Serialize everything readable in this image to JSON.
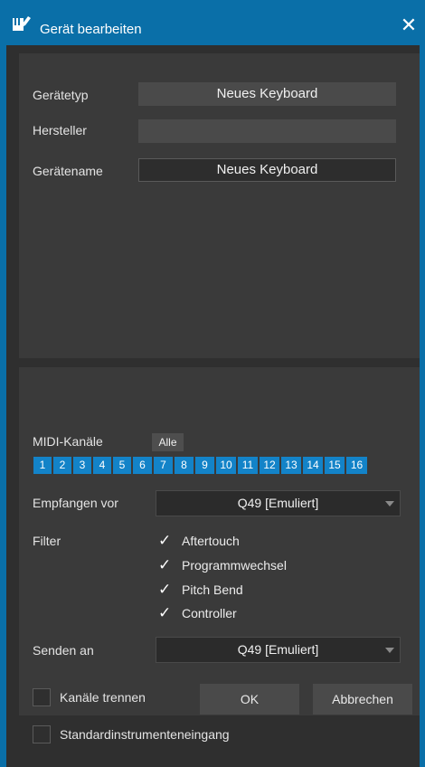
{
  "window": {
    "title": "Gerät bearbeiten",
    "close_glyph": "✕",
    "icon": "keyboard-app-icon"
  },
  "device": {
    "type_label": "Gerätetyp",
    "type_value": "Neues Keyboard",
    "manufacturer_label": "Hersteller",
    "manufacturer_value": "",
    "name_label": "Gerätename",
    "name_value": "Neues Keyboard"
  },
  "midi": {
    "channels_label": "MIDI-Kanäle",
    "all_label": "Alle",
    "channels": [
      "1",
      "2",
      "3",
      "4",
      "5",
      "6",
      "7",
      "8",
      "9",
      "10",
      "11",
      "12",
      "13",
      "14",
      "15",
      "16"
    ],
    "receive_label": "Empfangen vor",
    "receive_value": "Q49 [Emuliert]",
    "filter_label": "Filter",
    "filters": [
      "Aftertouch",
      "Programmwechsel",
      "Pitch Bend",
      "Controller"
    ],
    "check_glyph": "✓",
    "send_label": "Senden an",
    "send_value": "Q49 [Emuliert]",
    "split_channels_label": "Kanäle trennen",
    "default_input_label": "Standardinstrumenteneingang"
  },
  "buttons": {
    "ok": "OK",
    "cancel": "Abbrechen"
  },
  "colors": {
    "accent": "#1383c8",
    "titlebar": "#0a6fa8"
  }
}
